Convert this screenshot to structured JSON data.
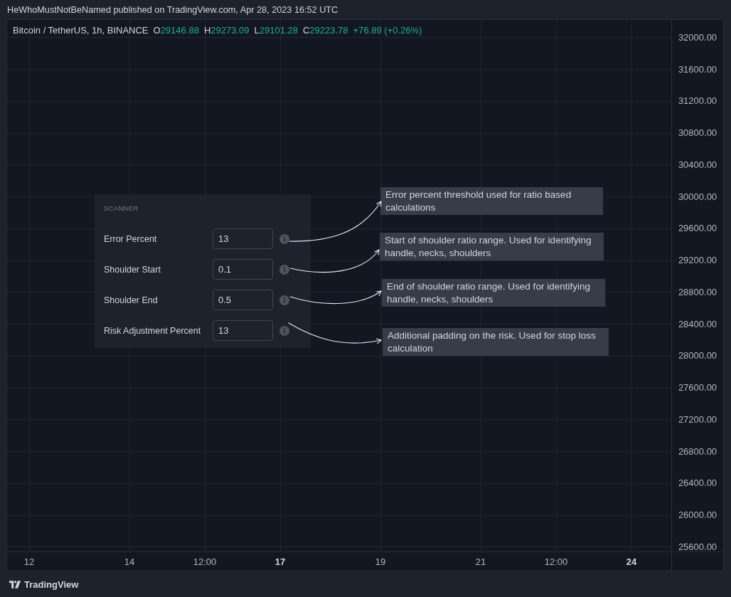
{
  "header": {
    "text": "HeWhoMustNotBeNamed published on TradingView.com, Apr 28, 2023 16:52 UTC"
  },
  "legend": {
    "symbol": "Bitcoin / TetherUS, 1h, BINANCE",
    "ohlc": [
      {
        "label": "O",
        "value": "29146.88"
      },
      {
        "label": "H",
        "value": "29273.09"
      },
      {
        "label": "L",
        "value": "29101.28"
      },
      {
        "label": "C",
        "value": "29223.78"
      }
    ],
    "change": "+76.89 (+0.26%)"
  },
  "settings_panel": {
    "title": "SCANNER",
    "fields": [
      {
        "label": "Error Percent",
        "value": "13",
        "tooltip": "Error percent threshold used for ratio based calculations"
      },
      {
        "label": "Shoulder Start",
        "value": "0.1",
        "tooltip": "Start of shoulder ratio range. Used for identifying handle, necks, shoulders"
      },
      {
        "label": "Shoulder End",
        "value": "0.5",
        "tooltip": "End of shoulder ratio range. Used for identifying handle, necks, shoulders"
      },
      {
        "label": "Risk Adjustment Percent",
        "value": "13",
        "tooltip": "Additional padding on the risk. Used for stop loss calculation"
      }
    ]
  },
  "price_scale": {
    "labels": [
      "32000.00",
      "31600.00",
      "31200.00",
      "30800.00",
      "30400.00",
      "30000.00",
      "29600.00",
      "29200.00",
      "28800.00",
      "28400.00",
      "28000.00",
      "27600.00",
      "27200.00",
      "26800.00",
      "26400.00",
      "26000.00",
      "25600.00"
    ]
  },
  "time_scale": {
    "labels": [
      {
        "text": "12",
        "major": false
      },
      {
        "text": "14",
        "major": false
      },
      {
        "text": "12:00",
        "major": false
      },
      {
        "text": "17",
        "major": true
      },
      {
        "text": "19",
        "major": false
      },
      {
        "text": "21",
        "major": false
      },
      {
        "text": "12:00",
        "major": false
      },
      {
        "text": "24",
        "major": true
      }
    ]
  },
  "footer": {
    "brand": "TradingView"
  }
}
